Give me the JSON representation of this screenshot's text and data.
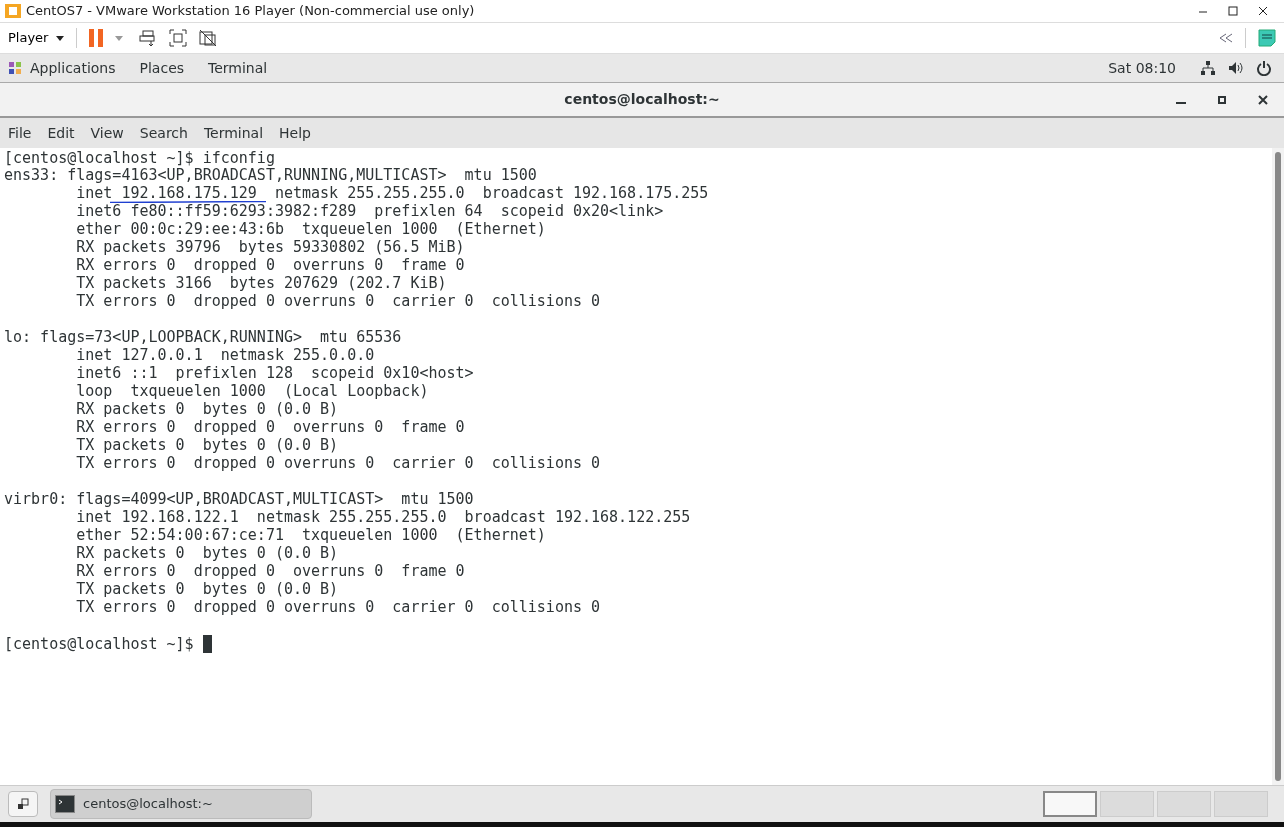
{
  "host_window": {
    "title": "CentOS7 - VMware Workstation 16 Player (Non-commercial use only)"
  },
  "player_toolbar": {
    "menu": "Player",
    "paused": true
  },
  "top_bar": {
    "menus": [
      "Applications",
      "Places",
      "Terminal"
    ],
    "clock": "Sat 08:10"
  },
  "terminal_window": {
    "title": "centos@localhost:~",
    "menus": [
      "File",
      "Edit",
      "View",
      "Search",
      "Terminal",
      "Help"
    ]
  },
  "terminal_output": {
    "command_line": "[centos@localhost ~]$ ifconfig",
    "blocks": [
      [
        "ens33: flags=4163<UP,BROADCAST,RUNNING,MULTICAST>  mtu 1500",
        "        inet 192.168.175.129  netmask 255.255.255.0  broadcast 192.168.175.255",
        "        inet6 fe80::ff59:6293:3982:f289  prefixlen 64  scopeid 0x20<link>",
        "        ether 00:0c:29:ee:43:6b  txqueuelen 1000  (Ethernet)",
        "        RX packets 39796  bytes 59330802 (56.5 MiB)",
        "        RX errors 0  dropped 0  overruns 0  frame 0",
        "        TX packets 3166  bytes 207629 (202.7 KiB)",
        "        TX errors 0  dropped 0 overruns 0  carrier 0  collisions 0"
      ],
      [
        "lo: flags=73<UP,LOOPBACK,RUNNING>  mtu 65536",
        "        inet 127.0.0.1  netmask 255.0.0.0",
        "        inet6 ::1  prefixlen 128  scopeid 0x10<host>",
        "        loop  txqueuelen 1000  (Local Loopback)",
        "        RX packets 0  bytes 0 (0.0 B)",
        "        RX errors 0  dropped 0  overruns 0  frame 0",
        "        TX packets 0  bytes 0 (0.0 B)",
        "        TX errors 0  dropped 0 overruns 0  carrier 0  collisions 0"
      ],
      [
        "virbr0: flags=4099<UP,BROADCAST,MULTICAST>  mtu 1500",
        "        inet 192.168.122.1  netmask 255.255.255.0  broadcast 192.168.122.255",
        "        ether 52:54:00:67:ce:71  txqueuelen 1000  (Ethernet)",
        "        RX packets 0  bytes 0 (0.0 B)",
        "        RX errors 0  dropped 0  overruns 0  frame 0",
        "        TX packets 0  bytes 0 (0.0 B)",
        "        TX errors 0  dropped 0 overruns 0  carrier 0  collisions 0"
      ]
    ],
    "prompt": "[centos@localhost ~]$"
  },
  "taskbar": {
    "task": "centos@localhost:~",
    "workspaces": [
      {
        "selected": true
      },
      {
        "selected": false
      },
      {
        "selected": false
      },
      {
        "selected": false
      }
    ]
  }
}
